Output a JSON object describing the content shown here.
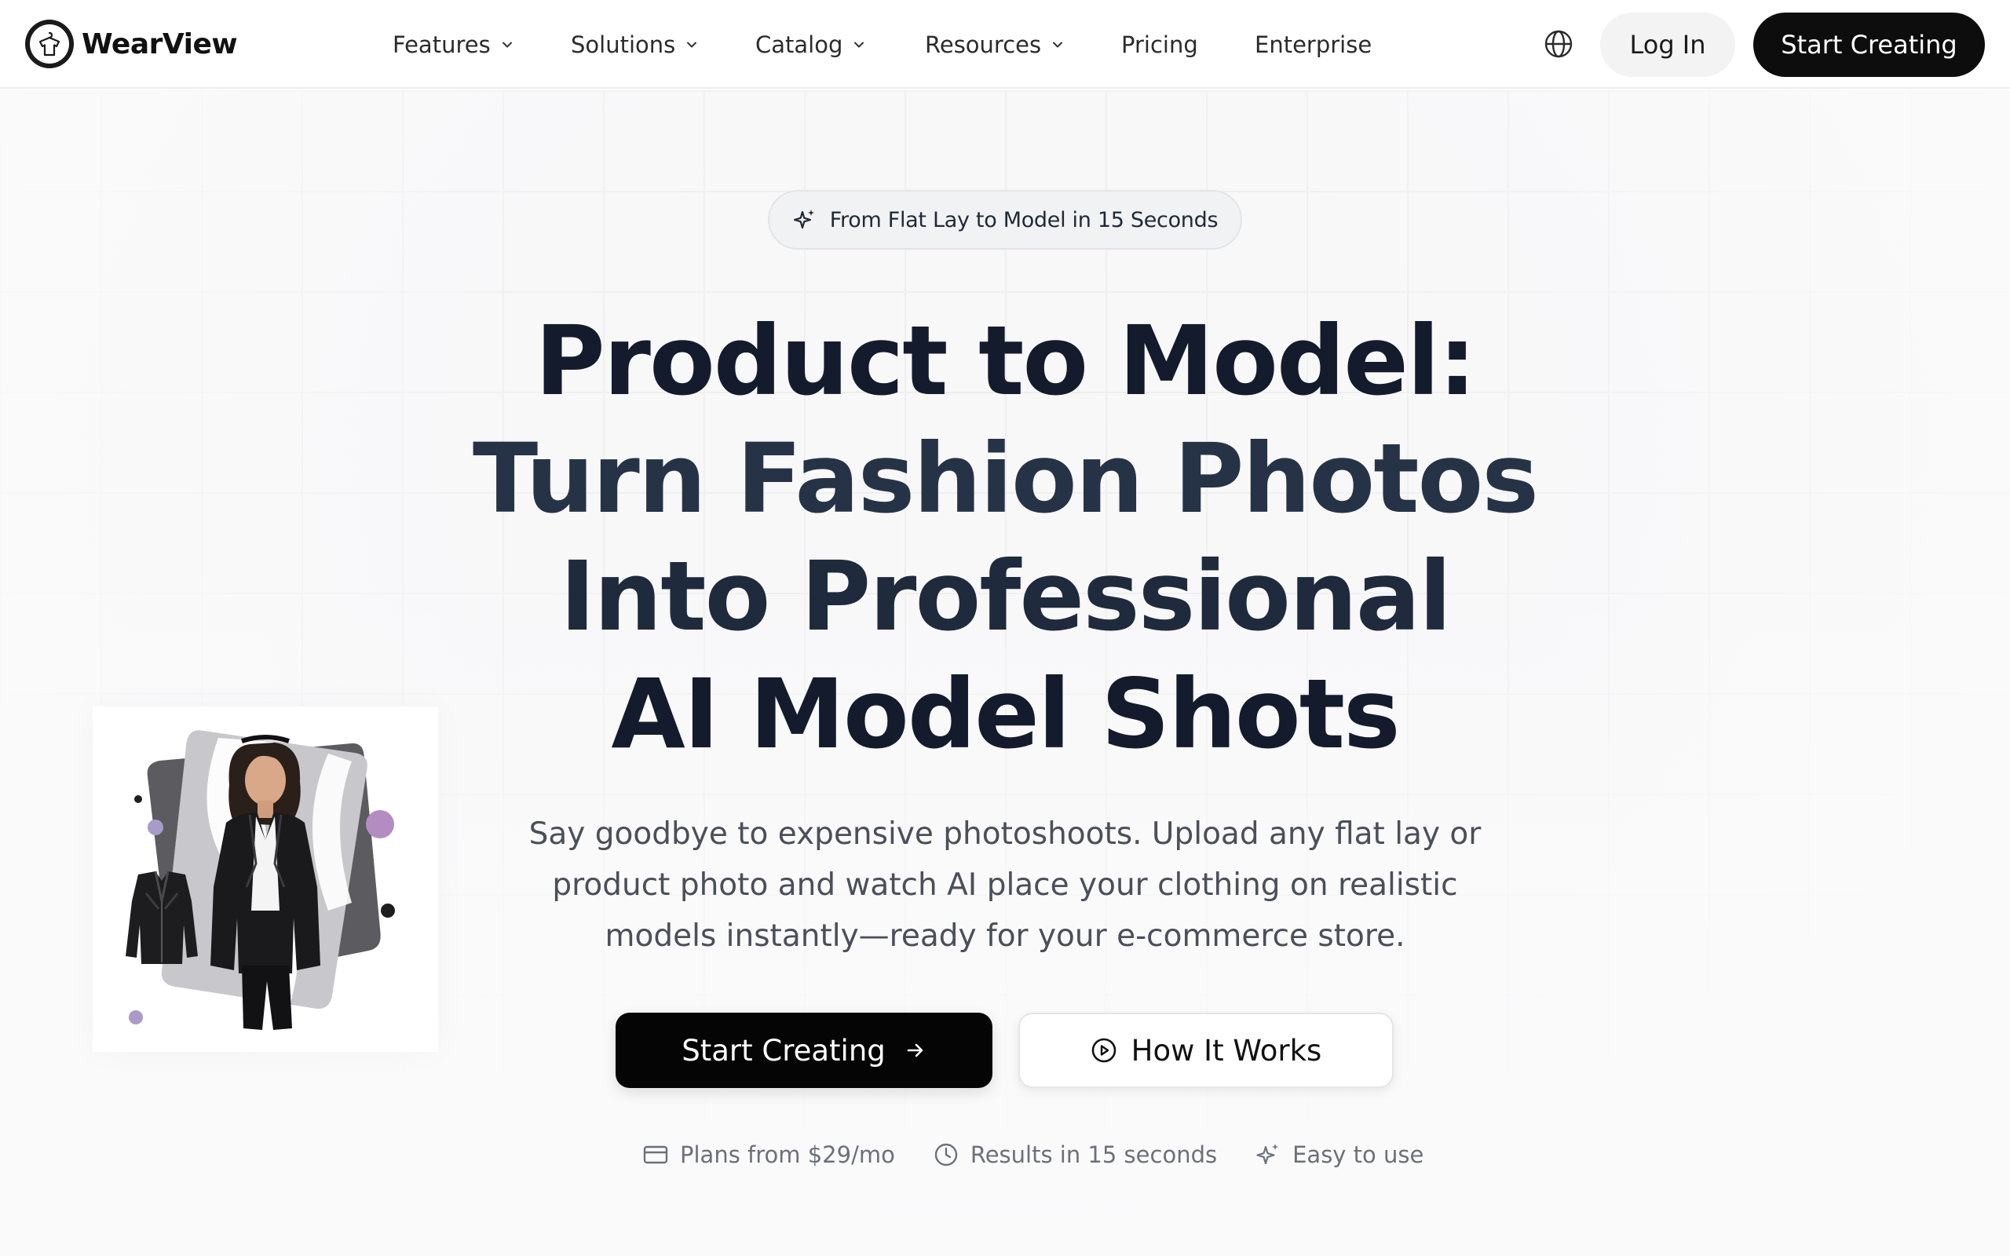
{
  "brand": {
    "name": "WearView",
    "logo_icon": "shirt-hanger-icon"
  },
  "nav": {
    "items": [
      {
        "label": "Features",
        "dropdown": true
      },
      {
        "label": "Solutions",
        "dropdown": true
      },
      {
        "label": "Catalog",
        "dropdown": true
      },
      {
        "label": "Resources",
        "dropdown": true
      },
      {
        "label": "Pricing",
        "dropdown": false
      },
      {
        "label": "Enterprise",
        "dropdown": false
      }
    ],
    "language_icon": "globe-icon",
    "login_label": "Log In",
    "start_label": "Start Creating"
  },
  "hero": {
    "badge": {
      "icon": "sparkles-icon",
      "text": "From Flat Lay to Model in 15 Seconds"
    },
    "headline": {
      "line1": "Product to Model:",
      "line2": "Turn Fashion Photos",
      "line3": "Into Professional",
      "line4": "AI Model Shots"
    },
    "subtitle": "Say goodbye to expensive photoshoots. Upload any flat lay or product photo and watch AI place your clothing on realistic models instantly—ready for your e-commerce store.",
    "cta_primary": {
      "label": "Start Creating",
      "icon": "arrow-right-icon"
    },
    "cta_secondary": {
      "label": "How It Works",
      "icon": "play-circle-icon"
    },
    "features": [
      {
        "icon": "credit-card-icon",
        "label": "Plans from $29/mo"
      },
      {
        "icon": "clock-icon",
        "label": "Results in 15 seconds"
      },
      {
        "icon": "sparkles-icon",
        "label": "Easy to use"
      }
    ]
  },
  "colors": {
    "primary": "#0d0d0d",
    "headline_dark": "#141b2d",
    "headline_slate": "#263347",
    "accent_purple": "#b38cc2",
    "muted_text": "#6b7079"
  }
}
